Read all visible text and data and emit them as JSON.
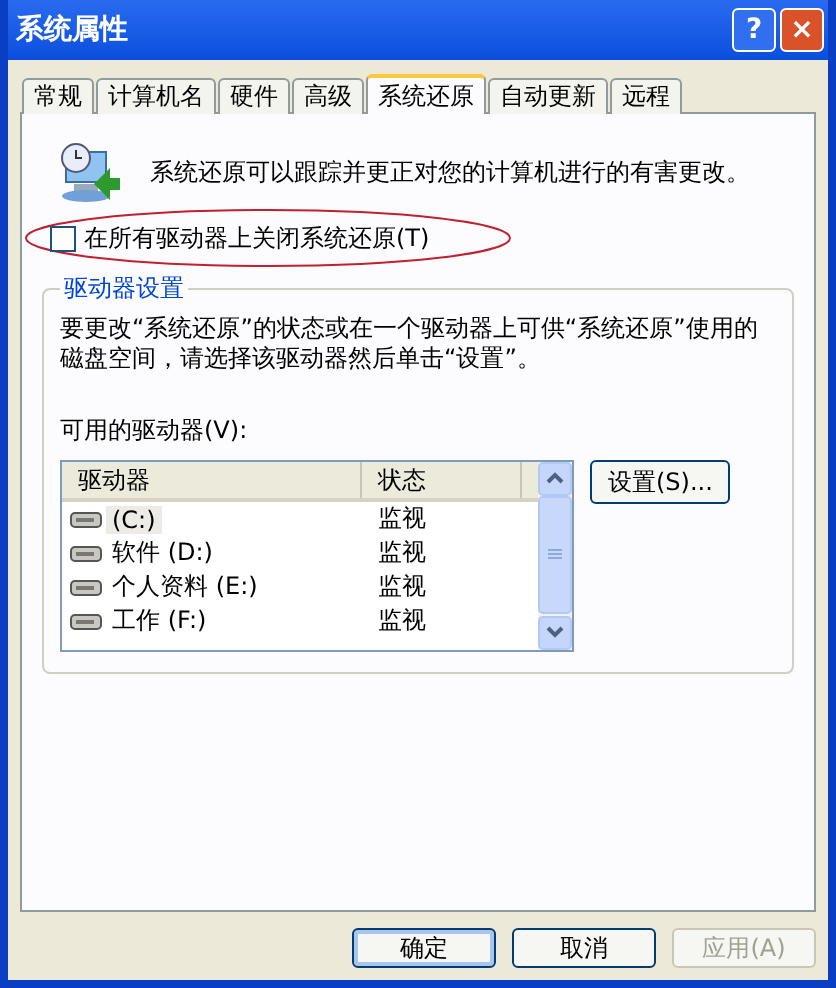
{
  "window": {
    "title": "系统属性",
    "help": "?",
    "close": "×"
  },
  "tabs": [
    {
      "label": "常规",
      "selected": false
    },
    {
      "label": "计算机名",
      "selected": false
    },
    {
      "label": "硬件",
      "selected": false
    },
    {
      "label": "高级",
      "selected": false
    },
    {
      "label": "系统还原",
      "selected": true
    },
    {
      "label": "自动更新",
      "selected": false
    },
    {
      "label": "远程",
      "selected": false
    }
  ],
  "intro": "系统还原可以跟踪并更正对您的计算机进行的有害更改。",
  "turn_off_option": {
    "label": "在所有驱动器上关闭系统还原(T)",
    "checked": false,
    "highlighted": true
  },
  "drive_settings": {
    "title": "驱动器设置",
    "description": "要更改“系统还原”的状态或在一个驱动器上可供“系统还原”使用的磁盘空间，请选择该驱动器然后单击“设置”。",
    "list_label": "可用的驱动器(V):",
    "columns": [
      "驱动器",
      "状态"
    ],
    "rows": [
      {
        "drive": "(C:)",
        "status": "监视",
        "selected": true
      },
      {
        "drive": "软件 (D:)",
        "status": "监视",
        "selected": false
      },
      {
        "drive": "个人资料 (E:)",
        "status": "监视",
        "selected": false
      },
      {
        "drive": "工作 (F:)",
        "status": "监视",
        "selected": false
      }
    ],
    "settings_button": "设置(S)..."
  },
  "buttons": [
    {
      "label": "确定",
      "default": true,
      "disabled": false
    },
    {
      "label": "取消",
      "default": false,
      "disabled": false
    },
    {
      "label": "应用(A)",
      "default": false,
      "disabled": true
    }
  ]
}
